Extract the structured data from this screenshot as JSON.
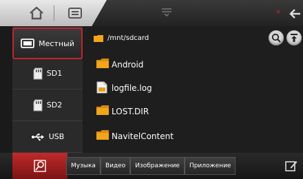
{
  "sidebar": {
    "items": [
      {
        "label": "Местный",
        "icon": "drive-icon"
      },
      {
        "label": "SD1",
        "icon": "sd-card-icon"
      },
      {
        "label": "SD2",
        "icon": "sd-card-icon"
      },
      {
        "label": "USB",
        "icon": "usb-icon"
      }
    ]
  },
  "path": "/mnt/sdcard",
  "files": [
    {
      "name": "Android",
      "icon": "folder-icon"
    },
    {
      "name": "logfile.log",
      "icon": "file-icon"
    },
    {
      "name": "LOST.DIR",
      "icon": "folder-icon"
    },
    {
      "name": "NavitelContent",
      "icon": "folder-icon"
    }
  ],
  "bottom_tabs": [
    {
      "label": "Музыка"
    },
    {
      "label": "Видео"
    },
    {
      "label": "Изображение"
    },
    {
      "label": "Приложение"
    }
  ],
  "colors": {
    "accent": "#c0262b",
    "folder": "#f2a51a"
  }
}
